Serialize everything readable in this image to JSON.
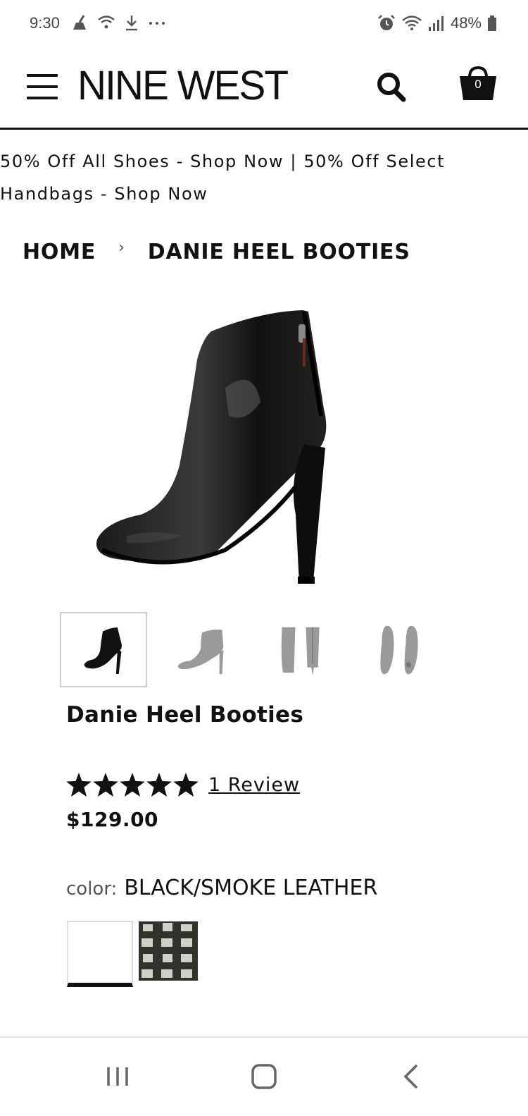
{
  "status_bar": {
    "time": "9:30",
    "battery": "48%",
    "icons": [
      "cleaner-icon",
      "wifi-question-icon",
      "download-icon",
      "more-dots-icon",
      "alarm-icon",
      "wifi-icon",
      "signal-icon",
      "battery-icon"
    ]
  },
  "header": {
    "logo": "NINE WEST",
    "cart_count": "0",
    "icons": [
      "menu-icon",
      "search-icon",
      "cart-icon"
    ]
  },
  "promo": {
    "part1": "50% Off All Shoes - Shop Now",
    "separator": " | ",
    "part2": "50% Off Select Handbags - Shop Now"
  },
  "breadcrumb": {
    "home": "HOME",
    "separator": "›",
    "current": "DANIE HEEL BOOTIES"
  },
  "product": {
    "title": "Danie Heel Booties",
    "review_text": "1 Review",
    "rating": 5,
    "rating_max": 5,
    "price": "$129.00",
    "color_label": "color:",
    "color_value": "BLACK/SMOKE LEATHER",
    "thumbnail_views": [
      "side",
      "side-alt",
      "front-back",
      "sole"
    ]
  },
  "colors": {
    "accent": "#111111",
    "muted": "#555555",
    "thumb_gray": "#9a9a9a"
  },
  "nav": {
    "icons": [
      "recent-apps-icon",
      "home-icon",
      "back-icon"
    ]
  }
}
